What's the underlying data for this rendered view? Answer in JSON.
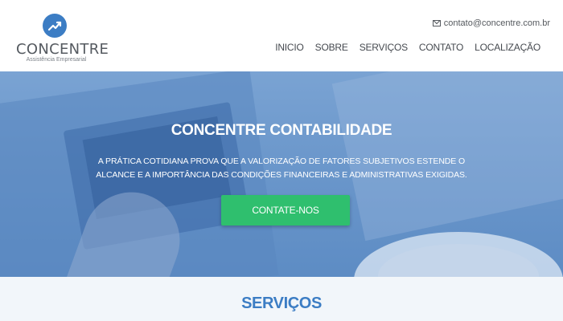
{
  "brand": {
    "name": "CONCENTRE",
    "tagline": "Assistência Empresarial",
    "accent_color": "#3c7dc4",
    "icon": "trending-up-icon"
  },
  "header": {
    "contact_email": "contato@concentre.com.br",
    "contact_icon": "mail-icon",
    "nav": [
      {
        "label": "INICIO"
      },
      {
        "label": "SOBRE"
      },
      {
        "label": "SERVIÇOS"
      },
      {
        "label": "CONTATO"
      },
      {
        "label": "LOCALIZAÇÃO"
      }
    ]
  },
  "hero": {
    "title": "CONCENTRE CONTABILIDADE",
    "text": "A PRÁTICA COTIDIANA PROVA QUE A VALORIZAÇÃO DE FATORES SUBJETIVOS ESTENDE O ALCANCE E A IMPORTÂNCIA DAS CONDIÇÕES FINANCEIRAS E ADMINISTRATIVAS EXIGIDAS.",
    "button_label": "CONTATE-NOS",
    "button_color": "#2fbf6e"
  },
  "services": {
    "title": "SERVIÇOS"
  }
}
